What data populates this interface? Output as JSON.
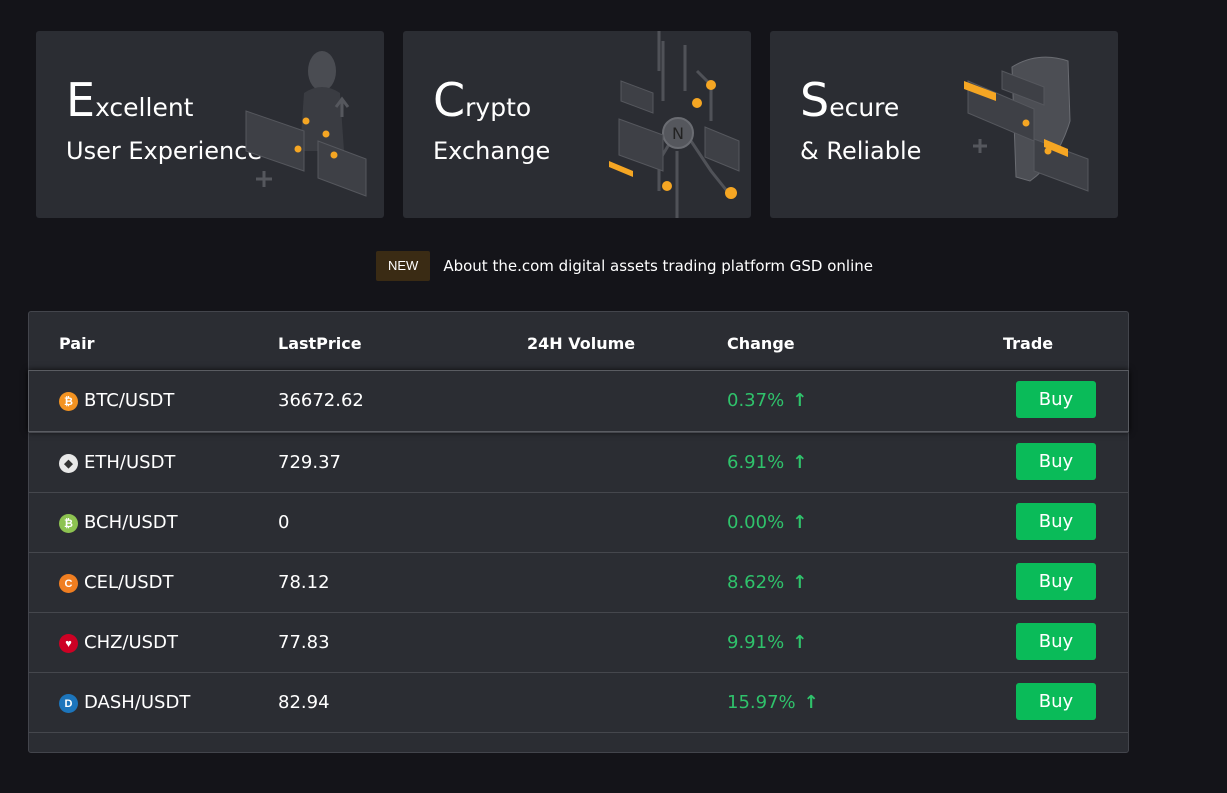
{
  "cards": [
    {
      "big": "E",
      "rest": "xcellent",
      "line2": "User Experience"
    },
    {
      "big": "C",
      "rest": "rypto",
      "line2": "Exchange"
    },
    {
      "big": "S",
      "rest": "ecure",
      "line2": "& Reliable"
    }
  ],
  "news": {
    "badge": "NEW",
    "text": "About the.com digital assets trading platform GSD online"
  },
  "table": {
    "headers": {
      "pair": "Pair",
      "last_price": "LastPrice",
      "volume": "24H Volume",
      "change": "Change",
      "trade": "Trade"
    },
    "rows": [
      {
        "pair": "BTC/USDT",
        "price": "36672.62",
        "volume": "",
        "change": "0.37%",
        "action": "Buy",
        "coin_color": "#f39321",
        "coin_glyph": "₿"
      },
      {
        "pair": "ETH/USDT",
        "price": "729.37",
        "volume": "",
        "change": "6.91%",
        "action": "Buy",
        "coin_color": "#e8e8e8",
        "coin_glyph": "◆"
      },
      {
        "pair": "BCH/USDT",
        "price": "0",
        "volume": "",
        "change": "0.00%",
        "action": "Buy",
        "coin_color": "#8dc351",
        "coin_glyph": "₿"
      },
      {
        "pair": "CEL/USDT",
        "price": "78.12",
        "volume": "",
        "change": "8.62%",
        "action": "Buy",
        "coin_color": "#f07e21",
        "coin_glyph": "C"
      },
      {
        "pair": "CHZ/USDT",
        "price": "77.83",
        "volume": "",
        "change": "9.91%",
        "action": "Buy",
        "coin_color": "#cd0124",
        "coin_glyph": "♥"
      },
      {
        "pair": "DASH/USDT",
        "price": "82.94",
        "volume": "",
        "change": "15.97%",
        "action": "Buy",
        "coin_color": "#1c75bc",
        "coin_glyph": "D"
      }
    ]
  },
  "colors": {
    "accent": "#0abb59",
    "positive": "#2fc26b",
    "card_bg": "#2b2d33",
    "page_bg": "#141419",
    "highlight": "#f5a623"
  }
}
